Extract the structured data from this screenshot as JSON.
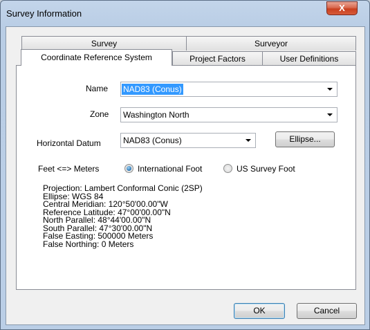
{
  "window": {
    "title": "Survey Information",
    "close_label": "X"
  },
  "tabs": {
    "row1": [
      {
        "label": "Survey"
      },
      {
        "label": "Surveyor"
      }
    ],
    "row2": [
      {
        "label": "Coordinate Reference System",
        "active": true
      },
      {
        "label": "Project Factors"
      },
      {
        "label": "User Definitions"
      }
    ]
  },
  "form": {
    "name_label": "Name",
    "name_value": "NAD83 (Conus)",
    "zone_label": "Zone",
    "zone_value": "Washington North",
    "datum_label": "Horizontal Datum",
    "datum_value": "NAD83 (Conus)",
    "ellipse_button": "Ellipse...",
    "units_label": "Feet <=> Meters",
    "units_options": [
      {
        "label": "International Foot",
        "selected": true
      },
      {
        "label": "US Survey Foot",
        "selected": false
      }
    ]
  },
  "projection_info": [
    "Projection: Lambert Conformal Conic (2SP)",
    "Ellipse: WGS 84",
    "Central Meridian: 120°50'00.00\"W",
    "Reference Latitude: 47°00'00.00\"N",
    "North Parallel: 48°44'00.00\"N",
    "South Parallel: 47°30'00.00\"N",
    "False Easting: 500000 Meters",
    "False Northing: 0 Meters"
  ],
  "buttons": {
    "ok": "OK",
    "cancel": "Cancel"
  },
  "colors": {
    "accent_selection": "#3399ff",
    "close_button": "#c9401f"
  }
}
